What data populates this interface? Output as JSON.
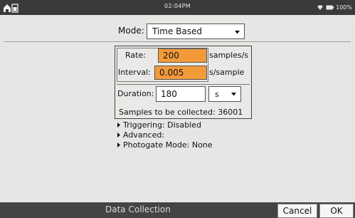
{
  "statusbar": {
    "time": "02:04PM",
    "battery": "100%",
    "icons": [
      "home-icon",
      "wifi-icon",
      "battery-icon"
    ]
  },
  "mode": {
    "label": "Mode:",
    "value": "Time Based"
  },
  "rate": {
    "rate_label": "Rate:",
    "rate_value": "200",
    "rate_unit": "samples/s",
    "interval_label": "Interval:",
    "interval_value": "0.005",
    "interval_unit": "s/sample",
    "duration_label": "Duration:",
    "duration_value": "180",
    "duration_unit": "s",
    "samples_text": "Samples to be collected: 36001"
  },
  "expanders": {
    "triggering": "Triggering: Disabled",
    "advanced": "Advanced:",
    "photogate": "Photogate Mode: None"
  },
  "bottombar": {
    "title": "Data Collection",
    "cancel": "Cancel",
    "ok": "OK"
  },
  "colors": {
    "highlight_field": "#f39a3b",
    "statusbar": "#3a3a3a",
    "bottombar": "#444444"
  }
}
